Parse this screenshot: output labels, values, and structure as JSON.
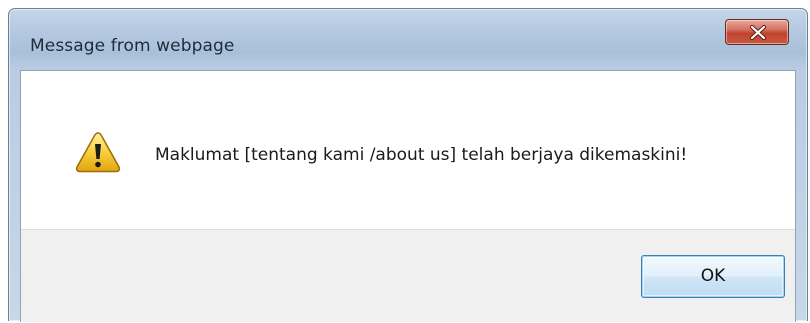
{
  "dialog": {
    "title": "Message from webpage",
    "message": "Maklumat [tentang kami /about us] telah berjaya dikemaskini!",
    "ok_label": "OK",
    "icon": "warning-icon",
    "close_icon": "close-icon"
  }
}
